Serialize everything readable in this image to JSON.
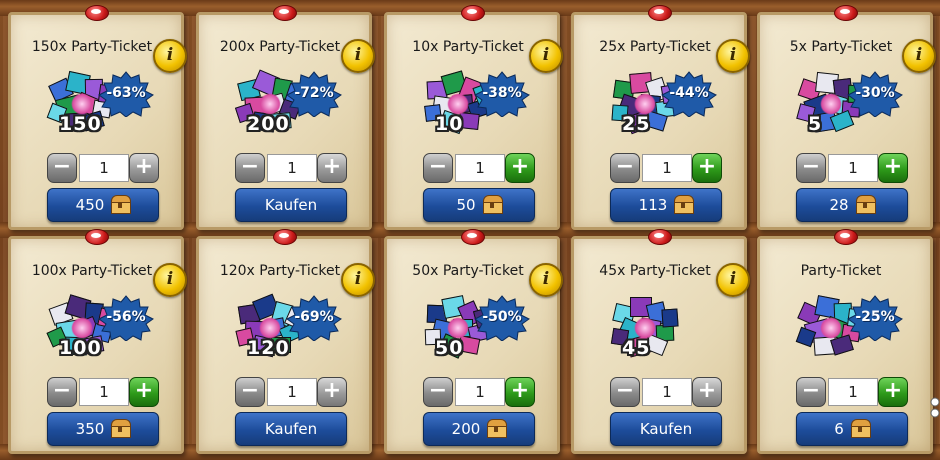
{
  "cards": [
    {
      "title": "150x Party-Ticket",
      "discount": "-63%",
      "qty_label": "150",
      "stepper_value": "1",
      "button_label": "450",
      "button_has_chest": true,
      "plus_green": false
    },
    {
      "title": "200x Party-Ticket",
      "discount": "-72%",
      "qty_label": "200",
      "stepper_value": "1",
      "button_label": "Kaufen",
      "button_has_chest": false,
      "plus_green": false
    },
    {
      "title": "10x Party-Ticket",
      "discount": "-38%",
      "qty_label": "10",
      "stepper_value": "1",
      "button_label": "50",
      "button_has_chest": true,
      "plus_green": true
    },
    {
      "title": "25x Party-Ticket",
      "discount": "-44%",
      "qty_label": "25",
      "stepper_value": "1",
      "button_label": "113",
      "button_has_chest": true,
      "plus_green": true
    },
    {
      "title": "5x Party-Ticket",
      "discount": "-30%",
      "qty_label": "5",
      "stepper_value": "1",
      "button_label": "28",
      "button_has_chest": true,
      "plus_green": true
    },
    {
      "title": "100x Party-Ticket",
      "discount": "-56%",
      "qty_label": "100",
      "stepper_value": "1",
      "button_label": "350",
      "button_has_chest": true,
      "plus_green": true
    },
    {
      "title": "120x Party-Ticket",
      "discount": "-69%",
      "qty_label": "120",
      "stepper_value": "1",
      "button_label": "Kaufen",
      "button_has_chest": false,
      "plus_green": false
    },
    {
      "title": "50x Party-Ticket",
      "discount": "-50%",
      "qty_label": "50",
      "stepper_value": "1",
      "button_label": "200",
      "button_has_chest": true,
      "plus_green": true
    },
    {
      "title": "45x Party-Ticket",
      "discount": "",
      "qty_label": "45",
      "stepper_value": "1",
      "button_label": "Kaufen",
      "button_has_chest": false,
      "plus_green": false
    },
    {
      "title": "Party-Ticket",
      "discount": "-25%",
      "qty_label": "",
      "stepper_value": "1",
      "button_label": "6",
      "button_has_chest": true,
      "plus_green": true
    }
  ],
  "stepper_symbols": {
    "minus": "−",
    "plus": "+"
  },
  "info_symbol": "i",
  "icons": {
    "pin": "pin-icon",
    "info": "info-icon",
    "chest": "treasure-chest-icon",
    "ticket_art": "party-ticket-icon"
  },
  "colors": {
    "button_blue": "#1d4c9a",
    "badge_blue": "#1f5aa8",
    "plus_green": "#2e9a1a",
    "info_gold": "#f2c200"
  }
}
